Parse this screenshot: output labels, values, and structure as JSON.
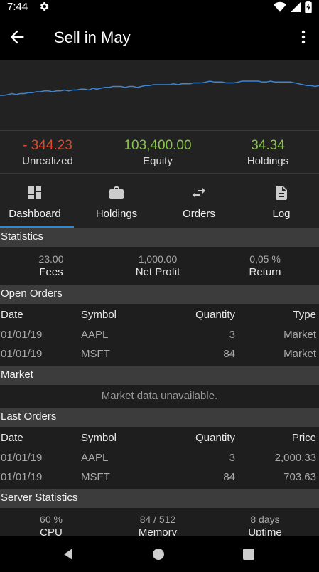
{
  "status_bar": {
    "time": "7:44"
  },
  "app_bar": {
    "title": "Sell in May"
  },
  "chart": {
    "series_color": "#3a86d6",
    "series": [
      {
        "values": [
          131,
          131,
          130,
          129,
          130,
          129,
          129,
          128,
          128,
          127,
          127,
          126,
          126,
          127,
          126,
          126,
          125,
          126,
          125,
          125,
          124,
          124,
          125,
          123,
          124,
          123,
          122,
          122,
          121,
          121,
          121,
          122,
          121,
          121,
          122,
          121,
          120,
          120,
          119,
          119,
          119,
          119,
          119,
          118,
          119,
          118,
          118,
          118,
          117,
          117,
          117,
          116,
          115,
          116,
          116,
          116,
          117,
          117,
          117,
          116,
          115,
          115,
          115,
          115,
          115,
          116,
          116,
          115,
          116,
          116,
          116,
          116,
          116,
          117,
          118,
          119,
          120,
          120,
          121,
          120
        ]
      }
    ]
  },
  "summary": {
    "unrealized": {
      "value": "- 344.23",
      "label": "Unrealized",
      "color": "#e04a2a"
    },
    "equity": {
      "value": "103,400.00",
      "label": "Equity",
      "color": "#8bc34a"
    },
    "holdings": {
      "value": "34.34",
      "label": "Holdings",
      "color": "#8bc34a"
    }
  },
  "tabs": [
    {
      "label": "Dashboard",
      "icon": "dashboard-icon",
      "selected": true
    },
    {
      "label": "Holdings",
      "icon": "briefcase-icon",
      "selected": false
    },
    {
      "label": "Orders",
      "icon": "swap-icon",
      "selected": false
    },
    {
      "label": "Log",
      "icon": "document-icon",
      "selected": false
    }
  ],
  "accent_color": "#2b8ad8",
  "statistics": {
    "title": "Statistics",
    "fees": {
      "value": "23.00",
      "label": "Fees"
    },
    "net_profit": {
      "value": "1,000.00",
      "label": "Net Profit"
    },
    "return": {
      "value": "0,05 %",
      "label": "Return"
    }
  },
  "open_orders": {
    "title": "Open Orders",
    "headers": [
      "Date",
      "Symbol",
      "Quantity",
      "Type"
    ],
    "rows": [
      [
        "01/01/19",
        "AAPL",
        "3",
        "Market"
      ],
      [
        "01/01/19",
        "MSFT",
        "84",
        "Market"
      ]
    ]
  },
  "market": {
    "title": "Market",
    "message": "Market data unavailable."
  },
  "last_orders": {
    "title": "Last Orders",
    "headers": [
      "Date",
      "Symbol",
      "Quantity",
      "Price"
    ],
    "rows": [
      [
        "01/01/19",
        "AAPL",
        "3",
        "2,000.33"
      ],
      [
        "01/01/19",
        "MSFT",
        "84",
        "703.63"
      ]
    ]
  },
  "server_statistics": {
    "title": "Server Statistics",
    "cpu": {
      "value": "60 %",
      "label": "CPU"
    },
    "memory": {
      "value": "84 / 512",
      "label": "Memory"
    },
    "uptime": {
      "value": "8 days",
      "label": "Uptime"
    }
  }
}
